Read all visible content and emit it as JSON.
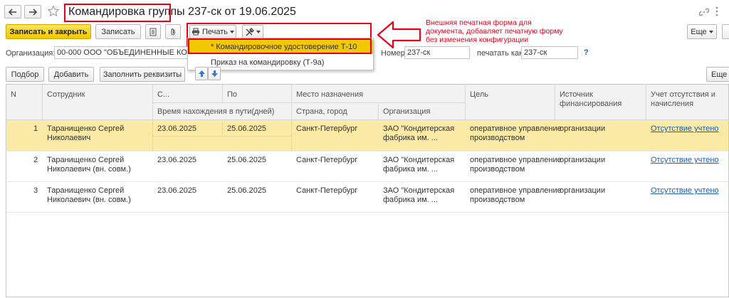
{
  "title": {
    "bold_part": "Командировка группы",
    "rest": " 237-ск от 19.06.2025"
  },
  "toolbar": {
    "save_close": "Записать и закрыть",
    "save": "Записать",
    "print": "Печать",
    "more": "Еще"
  },
  "print_menu": {
    "items": [
      "* Командировочное удостоверение Т-10",
      "Приказ на командировку (Т-9а)"
    ]
  },
  "annotation": "Внешняя печатная форма для документа, добавляет печатную форму без изменения конфигурации",
  "org_row": {
    "org_label": "Организация:",
    "org_value": "00-000 ООО \"ОБЪЕДИНЕННЫЕ КОНДИ",
    "number_label": "Номер:",
    "number_value": "237-ск",
    "print_as_label": "печатать как:",
    "print_as_value": "237-ск",
    "help": "?"
  },
  "table_toolbar": {
    "pick": "Подбор",
    "add": "Добавить",
    "fill": "Заполнить реквизиты",
    "more": "Еще"
  },
  "columns": {
    "n": "N",
    "employee": "Сотрудник",
    "from": "С...",
    "to": "По",
    "travel": "Время нахождения в пути(дней)",
    "destination": "Место назначения",
    "country_city": "Страна, город",
    "organization": "Организация",
    "goal": "Цель",
    "source_line1": "Источник",
    "source_line2": "финансирования",
    "absence_line1": "Учет отсутствия и",
    "absence_line2": "начисления"
  },
  "rows": [
    {
      "n": "1",
      "emp1": "Таранищенко Сергей",
      "emp2": "Николаевич",
      "from": "23.06.2025",
      "to": "25.06.2025",
      "city": "Санкт-Петербург",
      "org1": "ЗАО \"Кондитерская",
      "org2": "фабрика им. ...",
      "goal1": "оперативное управление",
      "goal2": "производством",
      "source": "организации",
      "absence": "Отсутствие учтено"
    },
    {
      "n": "2",
      "emp1": "Таранищенко Сергей",
      "emp2": "Николаевич (вн. совм.)",
      "from": "23.06.2025",
      "to": "25.06.2025",
      "city": "Санкт-Петербург",
      "org1": "ЗАО \"Кондитерская",
      "org2": "фабрика им. ...",
      "goal1": "оперативное управление",
      "goal2": "производством",
      "source": "организации",
      "absence": "Отсутствие учтено"
    },
    {
      "n": "3",
      "emp1": "Таранищенко Сергей",
      "emp2": "Николаевич (вн. совм.)",
      "from": "23.06.2025",
      "to": "25.06.2025",
      "city": "Санкт-Петербург",
      "org1": "ЗАО \"Кондитерская",
      "org2": "фабрика им. ...",
      "goal1": "оперативное управление",
      "goal2": "производством",
      "source": "организации",
      "absence": "Отсутствие учтено"
    }
  ],
  "colors": {
    "accent_red": "#e3001b",
    "selected_row": "#fbeaa5",
    "button_yellow": "#f2c800",
    "link": "#1a5fb4"
  }
}
